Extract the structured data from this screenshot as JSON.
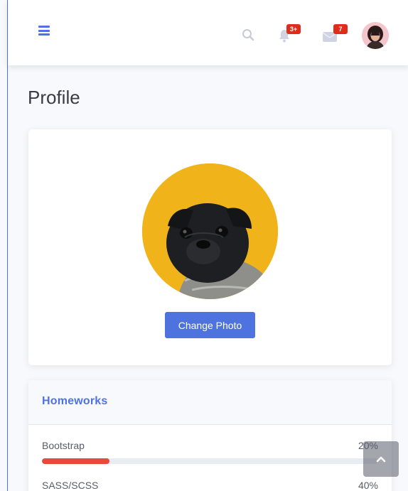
{
  "topbar": {
    "alerts_badge": "3+",
    "messages_badge": "7"
  },
  "icons": {
    "menu": "bars-icon",
    "search": "search-icon",
    "alerts": "bell-icon",
    "messages": "envelope-icon",
    "avatar": "user-avatar",
    "scroll_top": "chevron-up-icon"
  },
  "page": {
    "title": "Profile"
  },
  "profile": {
    "change_photo_label": "Change Photo"
  },
  "homeworks": {
    "title": "Homeworks",
    "items": [
      {
        "label": "Bootstrap",
        "percent_label": "20%",
        "value": 20,
        "color": "#e74a3b"
      },
      {
        "label": "SASS/SCSS",
        "percent_label": "40%",
        "value": 40,
        "color": "#f6c23e"
      }
    ]
  },
  "colors": {
    "primary": "#4e73df",
    "danger": "#e74a3b",
    "badge": "#e02d1b",
    "photo_background": "#f0b31a"
  }
}
